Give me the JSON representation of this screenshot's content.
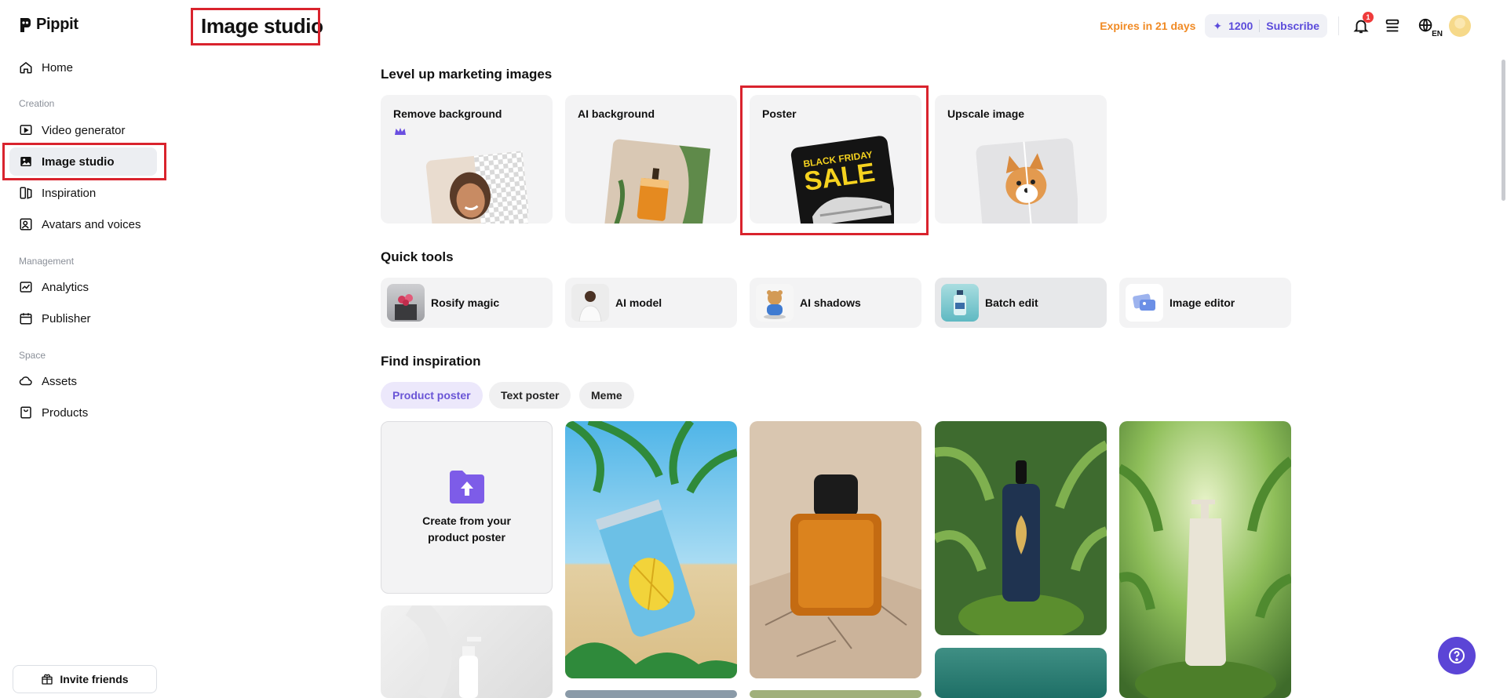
{
  "app": {
    "name": "Pippit"
  },
  "sidebar": {
    "home": "Home",
    "sections": {
      "creation": "Creation",
      "management": "Management",
      "space": "Space"
    },
    "items": {
      "video_generator": "Video generator",
      "image_studio": "Image studio",
      "inspiration": "Inspiration",
      "avatars_voices": "Avatars and voices",
      "analytics": "Analytics",
      "publisher": "Publisher",
      "assets": "Assets",
      "products": "Products"
    },
    "active_item": "Image studio",
    "invite": "Invite friends"
  },
  "header": {
    "title": "Image studio",
    "expires": "Expires in 21 days",
    "credits": "1200",
    "subscribe": "Subscribe",
    "notification_count": "1",
    "language": "EN"
  },
  "marketing": {
    "title": "Level up marketing images",
    "cards": [
      {
        "label": "Remove background"
      },
      {
        "label": "AI background"
      },
      {
        "label": "Poster",
        "art_text_1": "BLACK FRIDAY",
        "art_text_2": "SALE"
      },
      {
        "label": "Upscale image"
      }
    ]
  },
  "quick_tools": {
    "title": "Quick tools",
    "items": [
      "Rosify magic",
      "AI model",
      "AI shadows",
      "Batch edit",
      "Image editor"
    ]
  },
  "inspiration": {
    "title": "Find inspiration",
    "chips": [
      "Product poster",
      "Text poster",
      "Meme"
    ],
    "active_chip": "Product poster",
    "create_text": "Create from your product poster"
  },
  "colors": {
    "accent": "#5b45d6",
    "expires": "#f08a24",
    "highlight": "#d9232d",
    "badge": "#ef3b3b"
  }
}
